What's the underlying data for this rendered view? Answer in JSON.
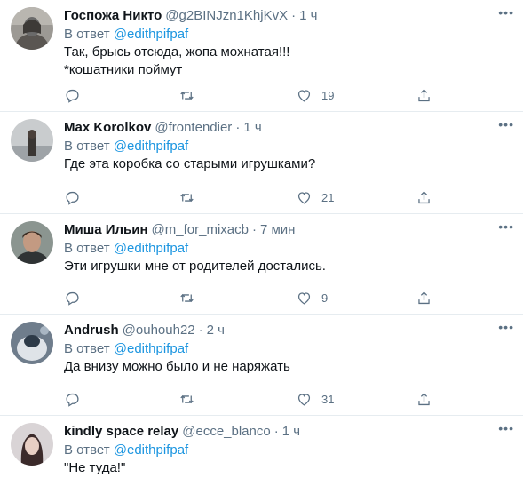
{
  "reply_prefix": "В ответ",
  "tweets": [
    {
      "name": "Госпожа Никто",
      "handle": "@g2BINJzn1KhjKvX",
      "time": "1 ч",
      "mention": "@edithpifpaf",
      "text": "Так, брысь отсюда, жопа мохнатая!!!\n*кошатники поймут",
      "likes": "19",
      "avatar_colors": [
        "#6a6a6a",
        "#b9b6b0"
      ]
    },
    {
      "name": "Max Korolkov",
      "handle": "@frontendier",
      "time": "1 ч",
      "mention": "@edithpifpaf",
      "text": "Где эта коробка со старыми игрушками?",
      "likes": "21",
      "avatar_colors": [
        "#c9ccce",
        "#3a3633"
      ]
    },
    {
      "name": "Миша Ильин",
      "handle": "@m_for_mixacb",
      "time": "7 мин",
      "mention": "@edithpifpaf",
      "text": "Эти игрушки мне от родителей достались.",
      "likes": "9",
      "avatar_colors": [
        "#8b9590",
        "#c39a82"
      ]
    },
    {
      "name": "Andrush",
      "handle": "@ouhouh22",
      "time": "2 ч",
      "mention": "@edithpifpaf",
      "text": "Да внизу можно было и не наряжать",
      "likes": "31",
      "avatar_colors": [
        "#6f7d8c",
        "#dfe3e8"
      ]
    },
    {
      "name": "kindly space relay",
      "handle": "@ecce_blanco",
      "time": "1 ч",
      "mention": "@edithpifpaf",
      "text": "\"Не туда!\"",
      "likes": "",
      "avatar_colors": [
        "#d9d4d6",
        "#3b2a2a"
      ]
    }
  ]
}
